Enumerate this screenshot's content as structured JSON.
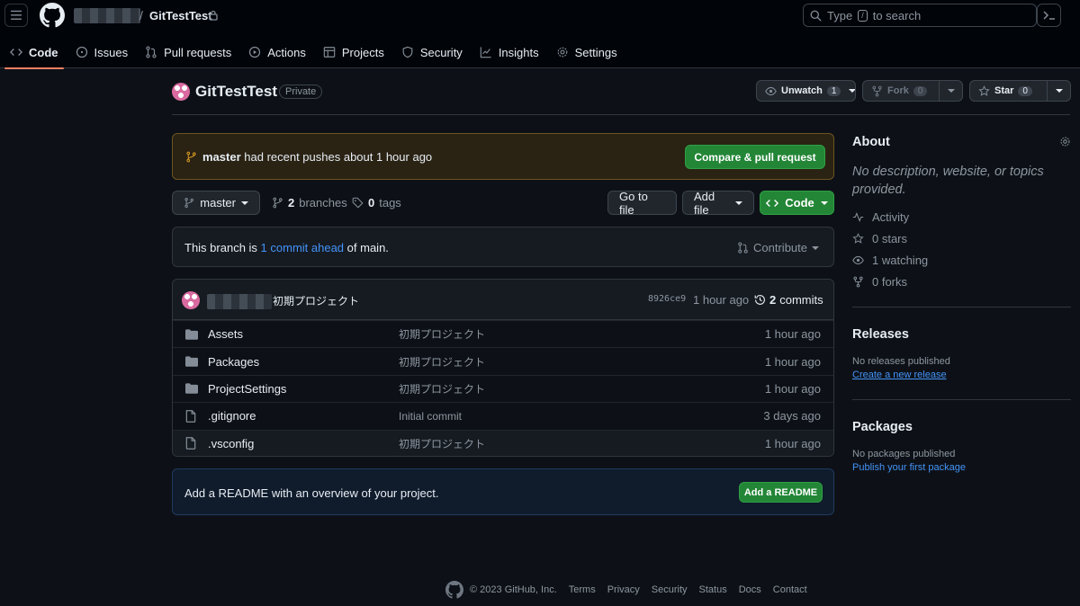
{
  "header": {
    "repo_name": "GitTestTest",
    "search_prefix": "Type",
    "search_key": "/",
    "search_suffix": "to search"
  },
  "nav": [
    {
      "label": "Code",
      "icon": "code-icon",
      "active": true
    },
    {
      "label": "Issues",
      "icon": "issue-opened-icon"
    },
    {
      "label": "Pull requests",
      "icon": "git-pull-request-icon"
    },
    {
      "label": "Actions",
      "icon": "play-icon"
    },
    {
      "label": "Projects",
      "icon": "table-icon"
    },
    {
      "label": "Security",
      "icon": "shield-icon"
    },
    {
      "label": "Insights",
      "icon": "graph-icon"
    },
    {
      "label": "Settings",
      "icon": "gear-icon"
    }
  ],
  "repo": {
    "title": "GitTestTest",
    "visibility": "Private",
    "unwatch_label": "Unwatch",
    "watch_count": "1",
    "fork_label": "Fork",
    "fork_count": "0",
    "star_label": "Star",
    "star_count": "0"
  },
  "push_banner": {
    "branch": "master",
    "text": "had recent pushes about 1 hour ago",
    "button": "Compare & pull request"
  },
  "branch_bar": {
    "current_branch": "master",
    "branch_count": "2",
    "branch_label": "branches",
    "tag_count": "0",
    "tag_label": "tags",
    "go_to_file": "Go to file",
    "add_file": "Add file",
    "code_button": "Code"
  },
  "ahead_banner": {
    "prefix": "This branch is",
    "link": "1 commit ahead",
    "suffix": "of main.",
    "contribute": "Contribute"
  },
  "latest_commit": {
    "message": "初期プロジェクト",
    "sha": "8926ce9",
    "time": "1 hour ago",
    "commit_count": "2",
    "commit_label": "commits"
  },
  "files": [
    {
      "name": "Assets",
      "type": "folder",
      "message": "初期プロジェクト",
      "date": "1 hour ago"
    },
    {
      "name": "Packages",
      "type": "folder",
      "message": "初期プロジェクト",
      "date": "1 hour ago"
    },
    {
      "name": "ProjectSettings",
      "type": "folder",
      "message": "初期プロジェクト",
      "date": "1 hour ago"
    },
    {
      "name": ".gitignore",
      "type": "file",
      "message": "Initial commit",
      "date": "3 days ago"
    },
    {
      "name": ".vsconfig",
      "type": "file",
      "message": "初期プロジェクト",
      "date": "1 hour ago"
    }
  ],
  "readme_banner": {
    "text": "Add a README with an overview of your project.",
    "button": "Add a README"
  },
  "sidebar": {
    "about_title": "About",
    "about_desc": "No description, website, or topics provided.",
    "activity": "Activity",
    "stars": "0 stars",
    "watching": "1 watching",
    "forks": "0 forks",
    "releases_title": "Releases",
    "releases_none": "No releases published",
    "releases_link": "Create a new release",
    "packages_title": "Packages",
    "packages_none": "No packages published",
    "packages_link": "Publish your first package"
  },
  "footer": {
    "copyright": "© 2023 GitHub, Inc.",
    "links": [
      "Terms",
      "Privacy",
      "Security",
      "Status",
      "Docs",
      "Contact"
    ]
  }
}
